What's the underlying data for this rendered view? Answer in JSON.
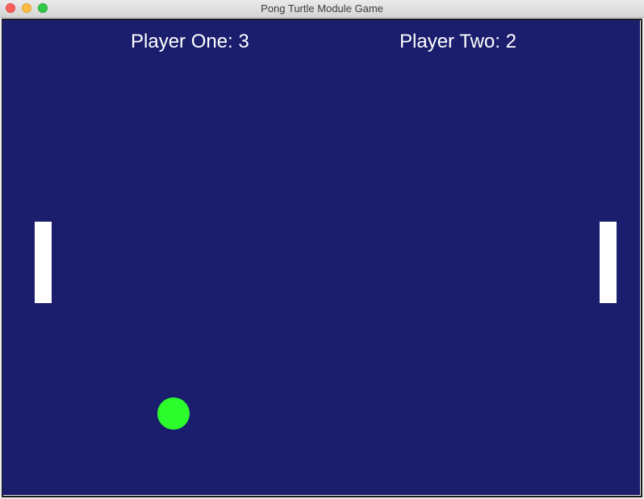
{
  "window": {
    "title": "Pong Turtle Module Game"
  },
  "scoreboard": {
    "player_one": "Player One: 3",
    "player_two": "Player Two: 2"
  },
  "colors": {
    "background": "#1a1e6c",
    "paddle": "#ffffff",
    "ball": "#2cfb2c",
    "text": "#ffffff"
  }
}
